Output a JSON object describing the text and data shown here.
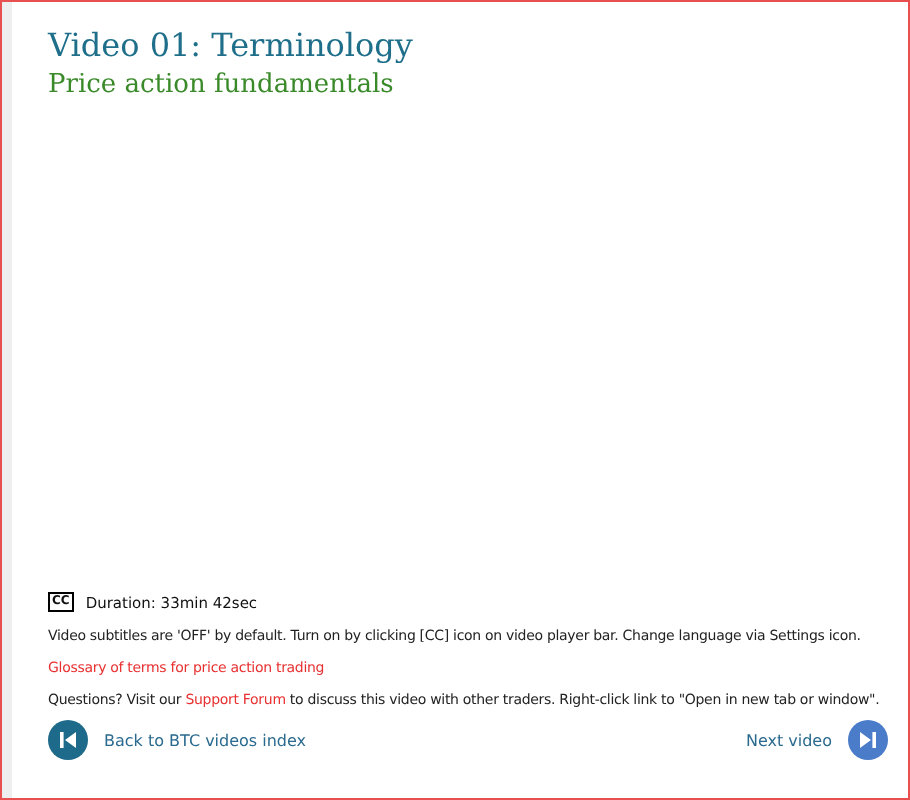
{
  "title": "Video 01: Terminology",
  "subtitle": "Price action fundamentals",
  "cc_icon": "CC",
  "duration": "Duration: 33min 42sec",
  "subtitles_note": "Video subtitles are 'OFF' by default. Turn on by clicking [CC] icon on video player bar. Change language via Settings icon.",
  "glossary_link": "Glossary of terms for price action trading",
  "questions": {
    "before": "Questions? Visit our ",
    "link": "Support Forum",
    "after": " to discuss this video with other traders. Right-click link to \"Open in new tab or window\"."
  },
  "nav": {
    "back": "Back to BTC videos index",
    "next": "Next video"
  }
}
